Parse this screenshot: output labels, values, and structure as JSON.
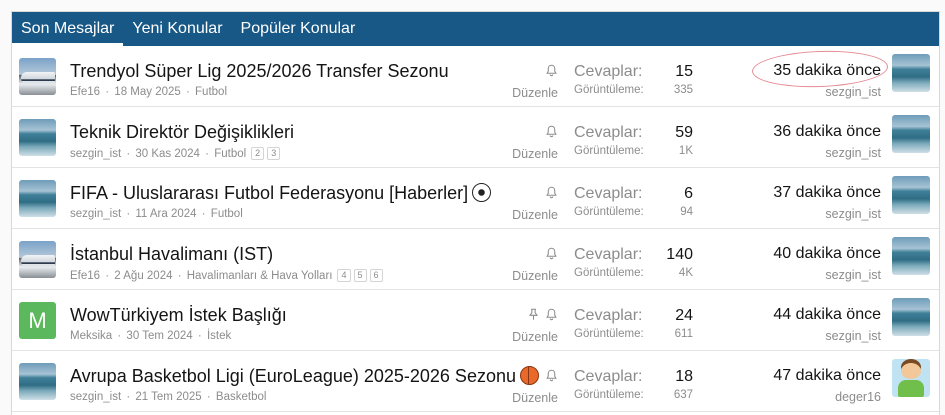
{
  "tabs": [
    {
      "label": "Son Mesajlar",
      "active": true
    },
    {
      "label": "Yeni Konular",
      "active": false
    },
    {
      "label": "Popüler Konular",
      "active": false
    }
  ],
  "labels": {
    "replies": "Cevaplar:",
    "views": "Görüntüleme:",
    "edit": "Düzenle"
  },
  "threads": [
    {
      "avatar": "train-avatar",
      "title": "Trendyol Süper Lig 2025/2026 Transfer Sezonu",
      "author": "Efe16",
      "date": "18 May 2025",
      "forum": "Futbol",
      "pages": [],
      "replies": "15",
      "views": "335",
      "last_time": "35 dakika önce",
      "last_user": "sezgin_ist",
      "last_avatar": "sea-avatar",
      "pinned": false,
      "emoji": ""
    },
    {
      "avatar": "sea-avatar",
      "title": "Teknik Direktör Değişiklikleri",
      "author": "sezgin_ist",
      "date": "30 Kas 2024",
      "forum": "Futbol",
      "pages": [
        "2",
        "3"
      ],
      "replies": "59",
      "views": "1K",
      "last_time": "36 dakika önce",
      "last_user": "sezgin_ist",
      "last_avatar": "sea-avatar",
      "pinned": false,
      "emoji": ""
    },
    {
      "avatar": "sea-avatar",
      "title": "FIFA - Uluslararası Futbol Federasyonu [Haberler]",
      "author": "sezgin_ist",
      "date": "11 Ara 2024",
      "forum": "Futbol",
      "pages": [],
      "replies": "6",
      "views": "94",
      "last_time": "37 dakika önce",
      "last_user": "sezgin_ist",
      "last_avatar": "sea-avatar",
      "pinned": false,
      "emoji": "soccer-ball-icon"
    },
    {
      "avatar": "train-avatar",
      "title": "İstanbul Havalimanı (IST)",
      "author": "Efe16",
      "date": "2 Ağu 2024",
      "forum": "Havalimanları & Hava Yolları",
      "pages": [
        "4",
        "5",
        "6"
      ],
      "replies": "140",
      "views": "4K",
      "last_time": "40 dakika önce",
      "last_user": "sezgin_ist",
      "last_avatar": "sea-avatar",
      "pinned": false,
      "emoji": ""
    },
    {
      "avatar": "letter-avatar",
      "avatar_letter": "M",
      "title": "WowTürkiyem İstek Başlığı",
      "author": "Meksika",
      "date": "30 Tem 2024",
      "forum": "İstek",
      "pages": [],
      "replies": "24",
      "views": "611",
      "last_time": "44 dakika önce",
      "last_user": "sezgin_ist",
      "last_avatar": "sea-avatar",
      "pinned": true,
      "emoji": ""
    },
    {
      "avatar": "sea-avatar",
      "title": "Avrupa Basketbol Ligi (EuroLeague) 2025-2026 Sezonu",
      "author": "sezgin_ist",
      "date": "21 Tem 2025",
      "forum": "Basketbol",
      "pages": [],
      "replies": "18",
      "views": "637",
      "last_time": "47 dakika önce",
      "last_user": "deger16",
      "last_avatar": "kid-avatar",
      "pinned": false,
      "emoji": "basketball-icon"
    }
  ],
  "colors": {
    "tab_bar": "#185886",
    "highlight_circle": "#e58a93",
    "letter_avatar": "#5cb85c"
  }
}
